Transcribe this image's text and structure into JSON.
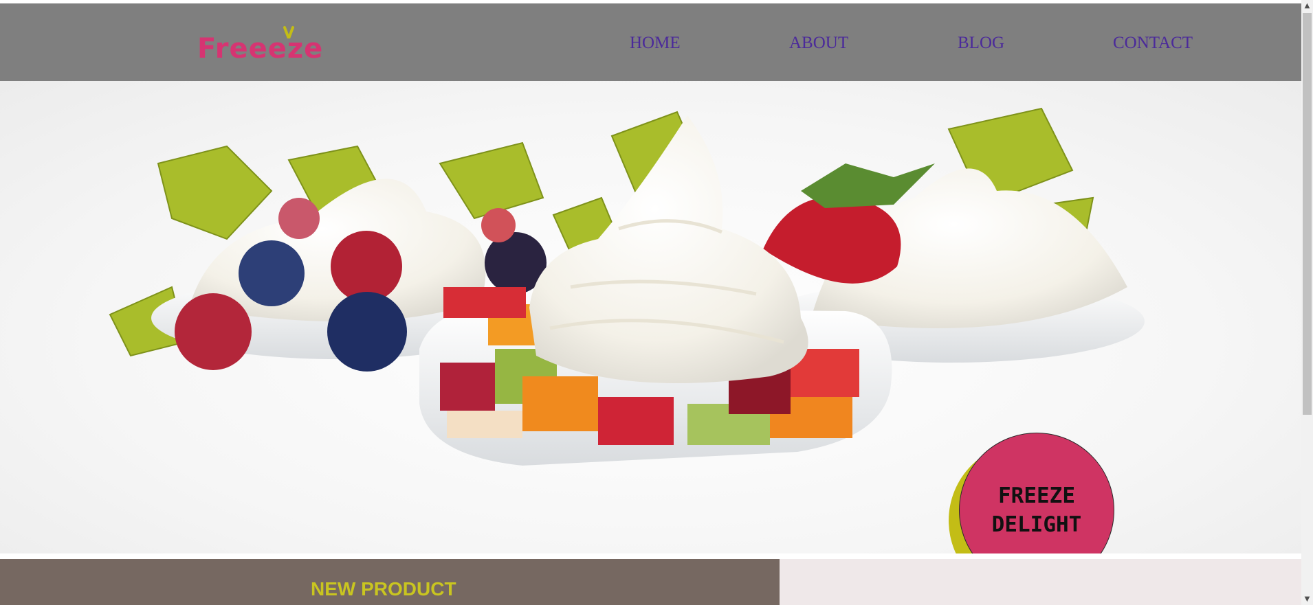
{
  "brand": {
    "logo_text": "Freeeze"
  },
  "nav": {
    "items": [
      {
        "label": "HOME"
      },
      {
        "label": "ABOUT"
      },
      {
        "label": "BLOG"
      },
      {
        "label": "CONTACT"
      }
    ]
  },
  "hero": {
    "badge_text": "FREEZE\nDELIGHT"
  },
  "sections": {
    "new_product_title": "NEW PRODUCT"
  },
  "colors": {
    "navbar": "#7f7f7f",
    "logo": "#d63472",
    "nav_link": "#4b2a9a",
    "badge": "#cf3463",
    "badge_shadow": "#c3bd16",
    "section_dark": "#766861",
    "section_title": "#c9c520",
    "section_light": "#efe8e9"
  },
  "icons": {
    "logo_sprout": "sprout-icon",
    "scroll_up": "chevron-up-icon",
    "scroll_down": "chevron-down-icon"
  }
}
